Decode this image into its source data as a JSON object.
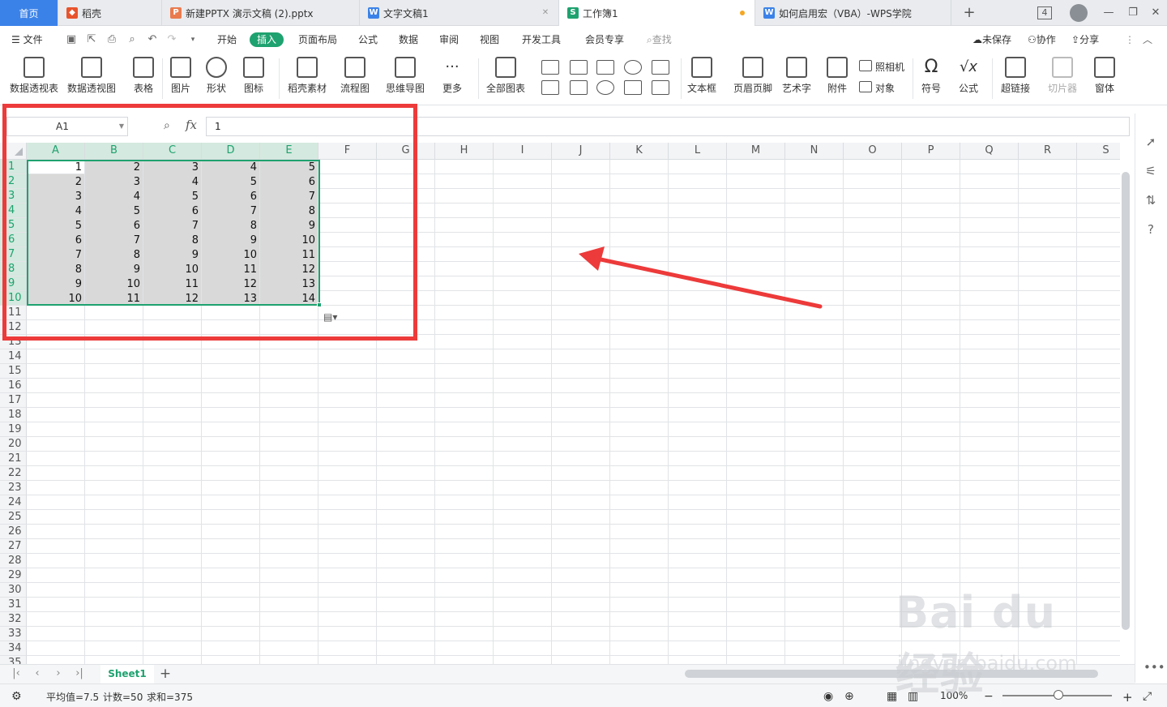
{
  "tabs": [
    {
      "label": "首页",
      "icon": "home",
      "state": "home"
    },
    {
      "label": "稻壳",
      "icon": "docer-icon",
      "color": "#e8532c"
    },
    {
      "label": "新建PPTX 演示文稿 (2).pptx",
      "icon": "ppt-icon",
      "color": "#e97b4e"
    },
    {
      "label": "文字文稿1",
      "icon": "word-icon",
      "color": "#3b82e8"
    },
    {
      "label": "工作簿1",
      "icon": "sheet-icon",
      "color": "#1ea26f",
      "state": "active",
      "unsaved": true
    },
    {
      "label": "如何启用宏（VBA）-WPS学院",
      "icon": "web-icon",
      "color": "#3b82e8"
    }
  ],
  "window": {
    "tab_count": "4",
    "new_tab": "+",
    "minimize": "—",
    "restore": "❐",
    "close": "✕"
  },
  "menu": {
    "file": "文件",
    "items": [
      "开始",
      "插入",
      "页面布局",
      "公式",
      "数据",
      "审阅",
      "视图",
      "开发工具",
      "会员专享"
    ],
    "active": "插入",
    "search": "查找",
    "unsaved": "未保存",
    "collab": "协作",
    "share": "分享"
  },
  "toolbar": {
    "pivot_table": "数据透视表",
    "pivot_chart": "数据透视图",
    "table": "表格",
    "picture": "图片",
    "shape": "形状",
    "icon": "图标",
    "docer_material": "稻壳素材",
    "flowchart": "流程图",
    "mindmap": "思维导图",
    "more": "更多",
    "all_charts": "全部图表",
    "textbox": "文本框",
    "header_footer": "页眉页脚",
    "wordart": "艺术字",
    "attachment": "附件",
    "camera": "照相机",
    "object": "对象",
    "symbol": "符号",
    "formula": "公式",
    "hyperlink": "超链接",
    "slicer": "切片器",
    "form": "窗体"
  },
  "formula_bar": {
    "name_box": "A1",
    "fx": "fx",
    "value": "1"
  },
  "grid": {
    "columns": [
      "A",
      "B",
      "C",
      "D",
      "E",
      "F",
      "G",
      "H",
      "I",
      "J",
      "K",
      "L",
      "M",
      "N",
      "O",
      "P",
      "Q",
      "R",
      "S"
    ],
    "rows": [
      "1",
      "2",
      "3",
      "4",
      "5",
      "6",
      "7",
      "8",
      "9",
      "10",
      "11",
      "12",
      "13",
      "14",
      "15",
      "16",
      "17",
      "18",
      "19",
      "20",
      "21",
      "22",
      "23",
      "24",
      "25",
      "26",
      "27",
      "28",
      "29",
      "30",
      "31",
      "32",
      "33",
      "34",
      "35"
    ],
    "data": [
      [
        "1",
        "2",
        "3",
        "4",
        "5"
      ],
      [
        "2",
        "3",
        "4",
        "5",
        "6"
      ],
      [
        "3",
        "4",
        "5",
        "6",
        "7"
      ],
      [
        "4",
        "5",
        "6",
        "7",
        "8"
      ],
      [
        "5",
        "6",
        "7",
        "8",
        "9"
      ],
      [
        "6",
        "7",
        "8",
        "9",
        "10"
      ],
      [
        "7",
        "8",
        "9",
        "10",
        "11"
      ],
      [
        "8",
        "9",
        "10",
        "11",
        "12"
      ],
      [
        "9",
        "10",
        "11",
        "12",
        "13"
      ],
      [
        "10",
        "11",
        "12",
        "13",
        "14"
      ]
    ],
    "selection": "A1:E10"
  },
  "sheets": {
    "active": "Sheet1",
    "add": "+"
  },
  "status": {
    "average": "平均值=7.5",
    "count": "计数=50",
    "sum": "求和=375",
    "zoom": "100%",
    "zoom_level": 1.0
  },
  "watermark": {
    "top": "Bai du 经验",
    "bottom": "jingyan.baidu.com"
  },
  "colors": {
    "accent": "#1ea26f",
    "highlight_box": "#ed3a3a",
    "home_tab": "#3b82e8",
    "selection_fill": "#d9d9d9"
  }
}
